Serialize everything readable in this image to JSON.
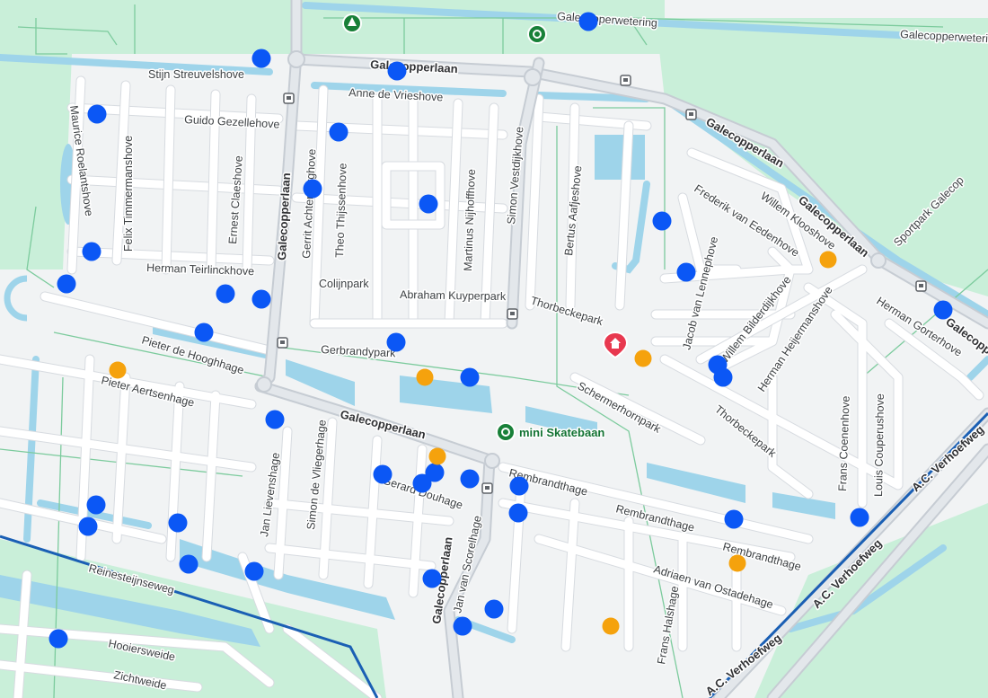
{
  "map": {
    "street_labels": [
      {
        "key": "galecopperwetering_n",
        "text": "Galecopperwetering"
      },
      {
        "key": "galecopperwetering_ne",
        "text": "Galecopperwetering"
      },
      {
        "key": "galecopperlaan_top",
        "text": "Galecopperlaan"
      },
      {
        "key": "stijn",
        "text": "Stijn Streuvelshove"
      },
      {
        "key": "anne",
        "text": "Anne de Vrieshove"
      },
      {
        "key": "guido",
        "text": "Guido Gezellehove"
      },
      {
        "key": "maurice",
        "text": "Maurice Roelantshove"
      },
      {
        "key": "felix",
        "text": "Felix Timmermanshove"
      },
      {
        "key": "ernest",
        "text": "Ernest Claeshove"
      },
      {
        "key": "galecopperlaan_v",
        "text": "Galecopperlaan"
      },
      {
        "key": "gerrit",
        "text": "Gerrit Achterberghove"
      },
      {
        "key": "theo",
        "text": "Theo Thijssenhove"
      },
      {
        "key": "martinus",
        "text": "Martinus Nijhoffhove"
      },
      {
        "key": "simon_v",
        "text": "Simon Vestdijkhove"
      },
      {
        "key": "bertus",
        "text": "Bertus Aafjeshove"
      },
      {
        "key": "galecopperlaan_ne",
        "text": "Galecopperlaan"
      },
      {
        "key": "frederik",
        "text": "Frederik van Eedenhove"
      },
      {
        "key": "willem",
        "text": "Willem Klooshove"
      },
      {
        "key": "galecopperlaan_e",
        "text": "Galecopperlaan"
      },
      {
        "key": "sportpark",
        "text": "Sportpark Galecop"
      },
      {
        "key": "herman_t",
        "text": "Herman Teirlinckhove"
      },
      {
        "key": "colijnpark",
        "text": "Colijnpark"
      },
      {
        "key": "abraham",
        "text": "Abraham Kuyperpark"
      },
      {
        "key": "thorbeckepark",
        "text": "Thorbeckepark"
      },
      {
        "key": "jacob",
        "text": "Jacob van Lennephove"
      },
      {
        "key": "willem_b",
        "text": "Willem Bilderdijkhove"
      },
      {
        "key": "herman_h",
        "text": "Herman Heijermanshove"
      },
      {
        "key": "herman_g",
        "text": "Herman Gorterhove"
      },
      {
        "key": "galecopperlaan_far",
        "text": "Galecopperlaan"
      },
      {
        "key": "pieter_h",
        "text": "Pieter de Hooghhage"
      },
      {
        "key": "gerbrandy",
        "text": "Gerbrandypark"
      },
      {
        "key": "pieter_a",
        "text": "Pieter Aertsenhage"
      },
      {
        "key": "schermerhorn",
        "text": "Schermerhornpark"
      },
      {
        "key": "thorbeckepark_2",
        "text": "Thorbeckepark"
      },
      {
        "key": "galecopperlaan_mid",
        "text": "Galecopperlaan"
      },
      {
        "key": "simon_vl",
        "text": "Simon de Vliegerhage"
      },
      {
        "key": "gerard",
        "text": "Gerard Douhage"
      },
      {
        "key": "rembrandthage_1",
        "text": "Rembrandthage"
      },
      {
        "key": "rembrandthage_2",
        "text": "Rembrandthage"
      },
      {
        "key": "rembrandthage_3",
        "text": "Rembrandthage"
      },
      {
        "key": "frans_c",
        "text": "Frans Coenenhove"
      },
      {
        "key": "louis",
        "text": "Louis Couperushove"
      },
      {
        "key": "jan_l",
        "text": "Jan Lievenshage"
      },
      {
        "key": "av_verhoefweg_top",
        "text": "A.C. Verhoefweg"
      },
      {
        "key": "av_verhoefweg_mid",
        "text": "A.C. Verhoefweg"
      },
      {
        "key": "av_verhoefweg_bot",
        "text": "A.C. Verhoefweg"
      },
      {
        "key": "reinesteijn",
        "text": "Reinesteijnseweg"
      },
      {
        "key": "adriaen",
        "text": "Adriaen van Ostadehage"
      },
      {
        "key": "galecopperlaan_s",
        "text": "Galecopperlaan"
      },
      {
        "key": "jan_s",
        "text": "Jan van Scorelhage"
      },
      {
        "key": "frans_h",
        "text": "Frans Halshage"
      },
      {
        "key": "hooiersweide",
        "text": "Hooiersweide"
      },
      {
        "key": "zichtweide",
        "text": "Zichtweide"
      }
    ],
    "poi": {
      "skatebaan": "mini Skatebaan"
    },
    "colors": {
      "background": "#f1f3f4",
      "park": "#c9efd9",
      "water": "#9ed4ea",
      "road": "#ffffff",
      "main_road": "#e3e7eb",
      "rail": "#1a5fb4",
      "marker_blue": "#0b57f5",
      "marker_orange": "#f5a20d",
      "poi_green": "#188038",
      "poi_red": "#e8384f"
    },
    "icons": [
      "tree-icon",
      "location-pin-icon",
      "bus-stop-icon",
      "home-pin-icon",
      "marker-dot-icon"
    ]
  }
}
